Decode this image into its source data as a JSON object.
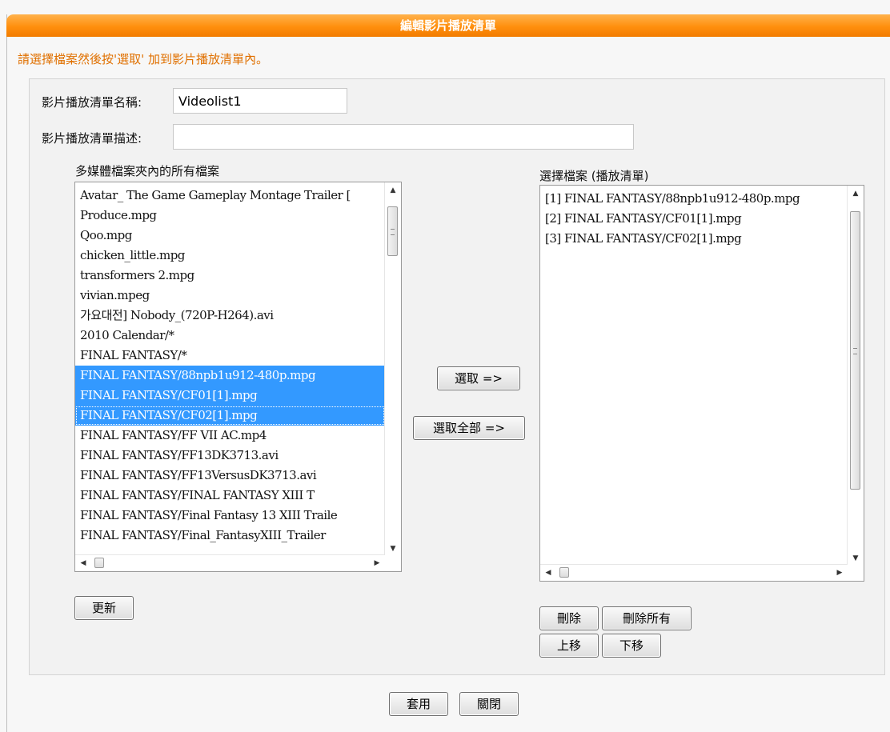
{
  "header": {
    "title": "編輯影片播放清單"
  },
  "instruction": "請選擇檔案然後按'選取' 加到影片播放清單內。",
  "form": {
    "name_label": "影片播放清單名稱:",
    "name_value": "Videolist1",
    "desc_label": "影片播放清單描述:",
    "desc_value": ""
  },
  "source_list": {
    "label": "多媒體檔案夾內的所有檔案",
    "items": [
      {
        "text": "Avatar_ The Game Gameplay Montage Trailer [",
        "selected": false
      },
      {
        "text": "Produce.mpg",
        "selected": false
      },
      {
        "text": "Qoo.mpg",
        "selected": false
      },
      {
        "text": "chicken_little.mpg",
        "selected": false
      },
      {
        "text": "transformers 2.mpg",
        "selected": false
      },
      {
        "text": "vivian.mpeg",
        "selected": false
      },
      {
        "text": "가요대전] Nobody_(720P-H264).avi",
        "selected": false
      },
      {
        "text": "2010 Calendar/*",
        "selected": false
      },
      {
        "text": "FINAL FANTASY/*",
        "selected": false
      },
      {
        "text": "FINAL FANTASY/88npb1u912-480p.mpg",
        "selected": true
      },
      {
        "text": "FINAL FANTASY/CF01[1].mpg",
        "selected": true
      },
      {
        "text": "FINAL FANTASY/CF02[1].mpg",
        "selected": true
      },
      {
        "text": "FINAL FANTASY/FF VII AC.mp4",
        "selected": false
      },
      {
        "text": "FINAL FANTASY/FF13DK3713.avi",
        "selected": false
      },
      {
        "text": "FINAL FANTASY/FF13VersusDK3713.avi",
        "selected": false
      },
      {
        "text": "FINAL FANTASY/FINAL FANTASY XIII T",
        "selected": false
      },
      {
        "text": "FINAL FANTASY/Final Fantasy 13 XIII Traile",
        "selected": false
      },
      {
        "text": "FINAL FANTASY/Final_FantasyXIII_Trailer",
        "selected": false
      }
    ]
  },
  "target_list": {
    "label": "選擇檔案 (播放清單)",
    "items": [
      {
        "text": "[1] FINAL FANTASY/88npb1u912-480p.mpg",
        "selected": false
      },
      {
        "text": "[2] FINAL FANTASY/CF01[1].mpg",
        "selected": false
      },
      {
        "text": "[3] FINAL FANTASY/CF02[1].mpg",
        "selected": false
      }
    ]
  },
  "buttons": {
    "select": "選取 =>",
    "select_all": "選取全部 =>",
    "refresh": "更新",
    "delete": "刪除",
    "delete_all": "刪除所有",
    "move_up": "上移",
    "move_down": "下移",
    "apply": "套用",
    "close": "關閉"
  },
  "icons": {
    "scroll_up": "▲",
    "scroll_down": "▼",
    "scroll_left": "◀",
    "scroll_right": "▶"
  },
  "colors": {
    "header_orange": "#ff8f0d",
    "instruction_text": "#e07000",
    "selection_blue": "#3399ff"
  }
}
